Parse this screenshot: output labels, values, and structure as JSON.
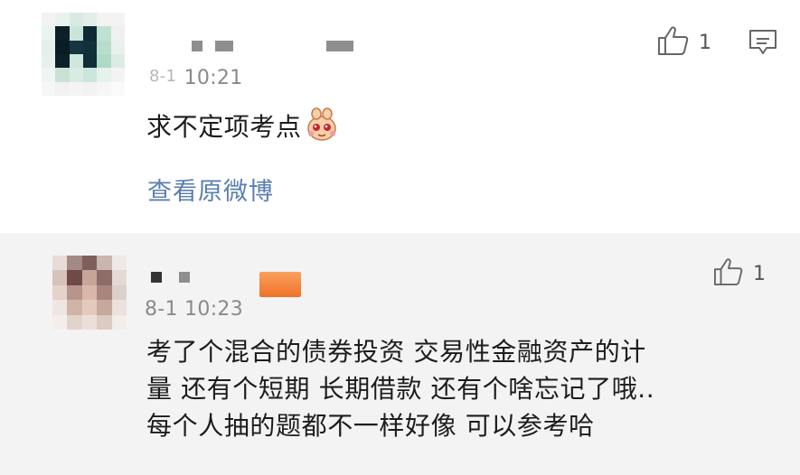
{
  "comments": [
    {
      "time_prefix": "8-1",
      "time": "10:21",
      "text": "求不定项考点",
      "link_text": "查看原微博",
      "like_count": "1",
      "icons": [
        "thumbs-up-icon",
        "reply-comment-icon",
        "emoji-sticker-icon"
      ]
    },
    {
      "time": "8-1 10:23",
      "text_lines": [
        "考了个混合的债券投资 交易性金融资产的计",
        "量 还有个短期 长期借款 还有个啥忘记了哦..",
        "每个人抽的题都不一样好像 可以参考哈"
      ],
      "like_count": "1",
      "icons": [
        "thumbs-up-icon"
      ]
    }
  ],
  "colors": {
    "link": "#5a7fb0",
    "timestamp": "#8a8a8a",
    "second_card_bg": "#f3f3f3",
    "name_badge": "#f27228"
  }
}
